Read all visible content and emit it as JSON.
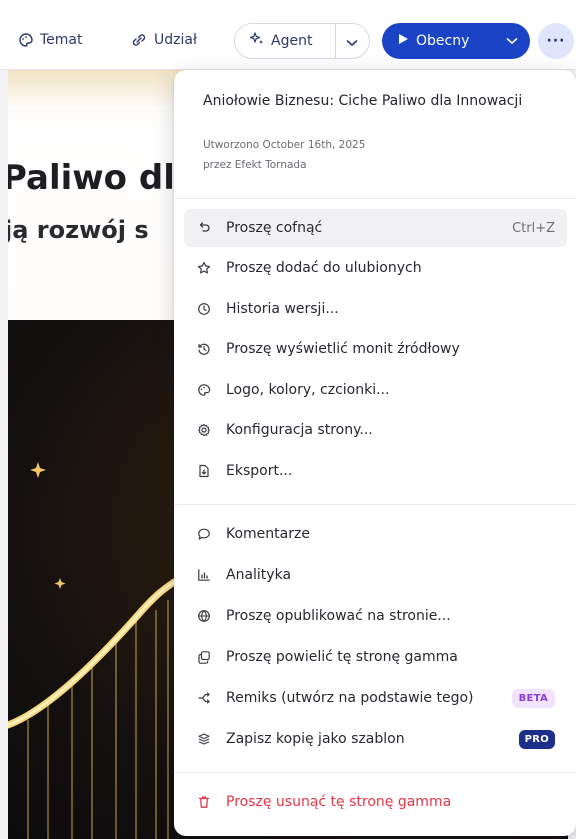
{
  "toolbar": {
    "temat_label": "Temat",
    "udzial_label": "Udział",
    "agent_label": "Agent",
    "obecny_label": "Obecny",
    "more_label": "···"
  },
  "slide": {
    "title": "Paliwo dl",
    "subtitle": "ją rozwój s"
  },
  "menu": {
    "doc_title": "Aniołowie Biznesu: Ciche Paliwo dla Innowacji",
    "created": "Utworzono October 16th, 2025",
    "author": "przez Efekt Tornada",
    "items": [
      {
        "label": "Proszę cofnąć",
        "shortcut": "Ctrl+Z",
        "icon": "undo-icon"
      },
      {
        "label": "Proszę dodać do ulubionych",
        "icon": "star-icon"
      },
      {
        "label": "Historia wersji...",
        "icon": "clock-icon"
      },
      {
        "label": "Proszę wyświetlić monit źródłowy",
        "icon": "history-icon"
      },
      {
        "label": "Logo, kolory, czcionki...",
        "icon": "palette-icon"
      },
      {
        "label": "Konfiguracja strony...",
        "icon": "gear-icon"
      },
      {
        "label": "Eksport...",
        "icon": "export-icon"
      },
      {
        "label": "Komentarze",
        "icon": "comment-icon"
      },
      {
        "label": "Analityka",
        "icon": "chart-icon"
      },
      {
        "label": "Proszę opublikować na stronie...",
        "icon": "globe-icon"
      },
      {
        "label": "Proszę powielić tę stronę gamma",
        "icon": "duplicate-icon"
      },
      {
        "label": "Remiks (utwórz na podstawie tego)",
        "badge": "BETA",
        "icon": "remix-icon"
      },
      {
        "label": "Zapisz kopię jako szablon",
        "badge": "PRO",
        "icon": "template-icon"
      },
      {
        "label": "Proszę usunąć tę stronę gamma",
        "icon": "trash-icon"
      }
    ]
  },
  "colors": {
    "accent": "#1a43c6",
    "danger": "#e53646",
    "beta_bg": "#f1e3ff",
    "pro_bg": "#1c2f8a"
  }
}
